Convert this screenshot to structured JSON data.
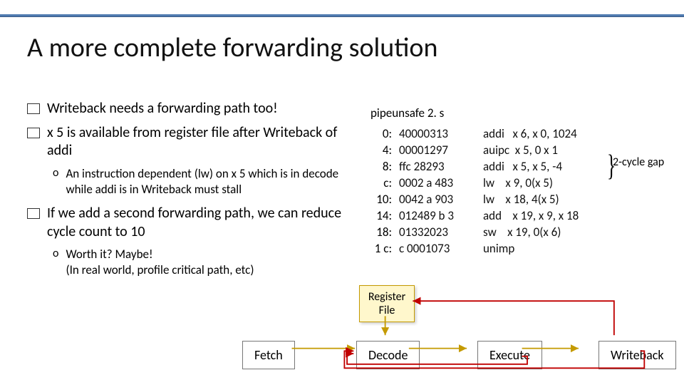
{
  "title": "A more complete forwarding solution",
  "bullets": {
    "b1": "Writeback needs a forwarding path too!",
    "b2": "x 5 is available from register file after Writeback of addi",
    "sub1": "An instruction dependent (lw) on x 5 which is in decode while addi is in Writeback must stall",
    "b3": "If we add a second forwarding path, we can reduce cycle count to 10",
    "sub2": "Worth it? Maybe!\n(In real world, profile critical path, etc)"
  },
  "code": {
    "filename": "pipeunsafe 2. s",
    "lines": [
      {
        "addr": "0:",
        "hex": "40000313",
        "mnem": "addi   x 6, x 0, 1024"
      },
      {
        "addr": "4:",
        "hex": "00001297",
        "mnem": "auipc  x 5, 0 x 1"
      },
      {
        "addr": "8:",
        "hex": "ffc 28293",
        "mnem": "addi   x 5, x 5, -4"
      },
      {
        "addr": "c:",
        "hex": "0002 a 483",
        "mnem": "lw    x 9, 0(x 5)"
      },
      {
        "addr": "10:",
        "hex": "0042 a 903",
        "mnem": "lw    x 18, 4(x 5)"
      },
      {
        "addr": "14:",
        "hex": "012489 b 3",
        "mnem": "add    x 19, x 9, x 18"
      },
      {
        "addr": "18:",
        "hex": "01332023",
        "mnem": "sw    x 19, 0(x 6)"
      },
      {
        "addr": "1 c:",
        "hex": "c 0001073",
        "mnem": "unimp"
      }
    ]
  },
  "gapnote": "2-cycle gap",
  "pipeline": {
    "regfile": "Register\nFile",
    "fetch": "Fetch",
    "decode": "Decode",
    "execute": "Execute",
    "writeback": "Writeback"
  }
}
